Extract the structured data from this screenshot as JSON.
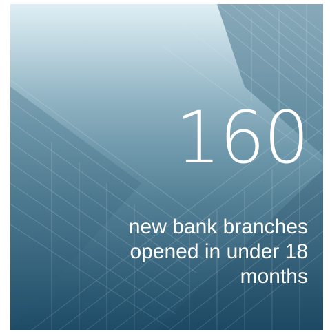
{
  "stat": {
    "number": "160",
    "caption": "new bank branches opened in under 18 months"
  },
  "colors": {
    "background_top": "#dfeef4",
    "background_bottom": "#265672",
    "text": "#ffffff"
  }
}
